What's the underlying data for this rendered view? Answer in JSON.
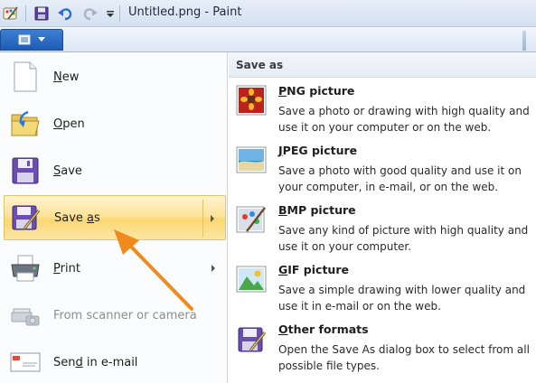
{
  "window": {
    "title": "Untitled.png - Paint"
  },
  "quick_access": {
    "items": [
      "save-icon",
      "undo-icon",
      "redo-icon",
      "customize-dropdown-icon"
    ]
  },
  "ribbon": {
    "file_tab": "paint-menu-icon"
  },
  "menu": {
    "items": [
      {
        "label_pre": "",
        "label_key": "N",
        "label_post": "ew",
        "icon": "new-document-icon"
      },
      {
        "label_pre": "",
        "label_key": "O",
        "label_post": "pen",
        "icon": "open-folder-icon"
      },
      {
        "label_pre": "",
        "label_key": "S",
        "label_post": "ave",
        "icon": "floppy-disk-icon"
      },
      {
        "label_pre": "Save ",
        "label_key": "a",
        "label_post": "s",
        "icon": "save-as-icon"
      },
      {
        "label_pre": "",
        "label_key": "P",
        "label_post": "rint",
        "icon": "printer-icon"
      },
      {
        "label_pre": "From scanner or camera",
        "label_key": "",
        "label_post": "",
        "icon": "scanner-icon"
      },
      {
        "label_pre": "Sen",
        "label_key": "d",
        "label_post": " in e-mail",
        "icon": "email-icon"
      }
    ]
  },
  "save_as_pane": {
    "header": "Save as",
    "formats": [
      {
        "key": "P",
        "rest": "NG picture",
        "desc": "Save a photo or drawing with high quality and use it on your computer or on the web.",
        "icon": "png-picture-icon"
      },
      {
        "key": "J",
        "rest": "PEG picture",
        "desc": "Save a photo with good quality and use it on your computer, in e-mail, or on the web.",
        "icon": "jpeg-picture-icon"
      },
      {
        "key": "B",
        "rest": "MP picture",
        "desc": "Save any kind of picture with high quality and use it on your computer.",
        "icon": "bmp-picture-icon"
      },
      {
        "key": "G",
        "rest": "IF picture",
        "desc": "Save a simple drawing with lower quality and use it in e-mail or on the web.",
        "icon": "gif-picture-icon"
      },
      {
        "key": "O",
        "rest": "ther formats",
        "desc": "Open the Save As dialog box to select from all possible file types.",
        "icon": "other-formats-icon"
      }
    ]
  },
  "colors": {
    "highlight": "#fbd772",
    "annotation_arrow": "#f08a1c",
    "file_tab": "#2a6bc4"
  }
}
